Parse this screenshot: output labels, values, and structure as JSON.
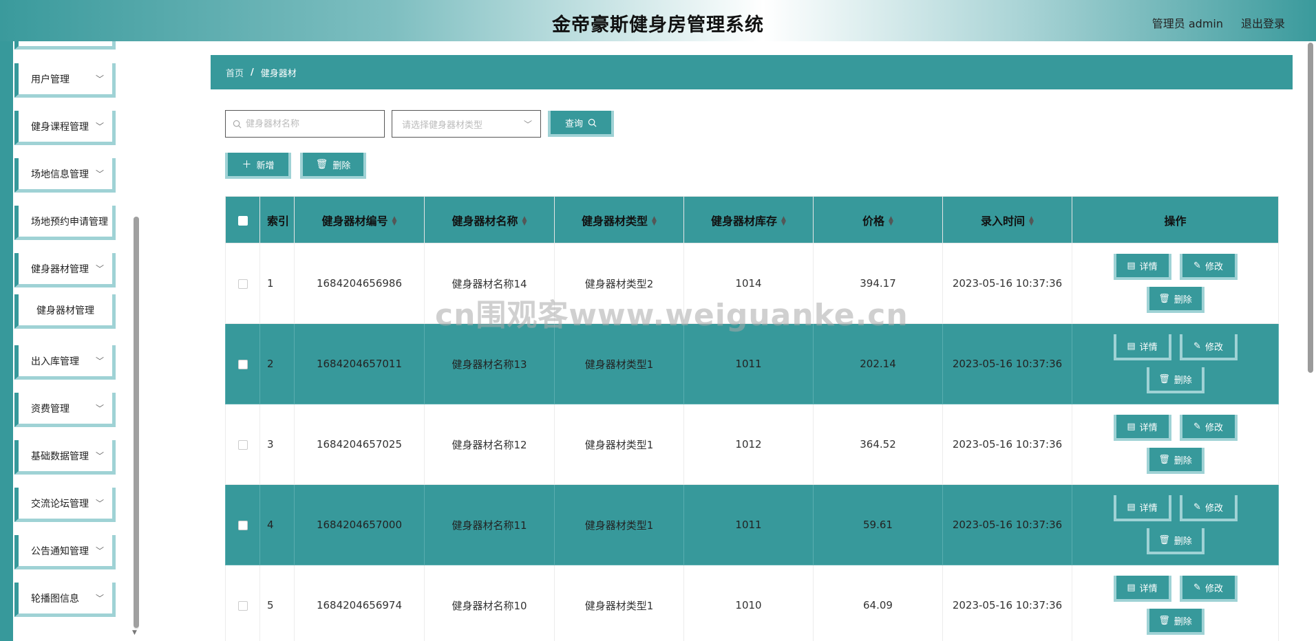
{
  "header": {
    "title": "金帝豪斯健身房管理系统",
    "user": "管理员 admin",
    "logout": "退出登录"
  },
  "sidebar": {
    "items": [
      {
        "label": "用户管理",
        "chevron": "﹀"
      },
      {
        "label": "健身课程管理",
        "chevron": "﹀"
      },
      {
        "label": "场地信息管理",
        "chevron": "﹀"
      },
      {
        "label": "场地预约申请管理",
        "chevron": ""
      },
      {
        "label": "健身器材管理",
        "chevron": "﹀"
      },
      {
        "label": "健身器材管理",
        "chevron": ""
      },
      {
        "label": "出入库管理",
        "chevron": "﹀"
      },
      {
        "label": "资费管理",
        "chevron": "﹀"
      },
      {
        "label": "基础数据管理",
        "chevron": "﹀"
      },
      {
        "label": "交流论坛管理",
        "chevron": "﹀"
      },
      {
        "label": "公告通知管理",
        "chevron": "﹀"
      },
      {
        "label": "轮播图信息",
        "chevron": "﹀"
      }
    ]
  },
  "breadcrumb": {
    "home": "首页",
    "sep": "/",
    "current": "健身器材"
  },
  "search": {
    "name_placeholder": "健身器材名称",
    "type_placeholder": "请选择健身器材类型",
    "query_label": "查询"
  },
  "toolbar": {
    "add_label": "新增",
    "delete_label": "删除"
  },
  "table": {
    "headers": {
      "index": "索引",
      "code": "健身器材编号",
      "name": "健身器材名称",
      "type": "健身器材类型",
      "stock": "健身器材库存",
      "price": "价格",
      "time": "录入时间",
      "ops": "操作"
    },
    "op_labels": {
      "detail": "详情",
      "edit": "修改",
      "delete": "删除"
    },
    "rows": [
      {
        "index": "1",
        "code": "1684204656986",
        "name": "健身器材名称14",
        "type": "健身器材类型2",
        "stock": "1014",
        "price": "394.17",
        "time": "2023-05-16 10:37:36"
      },
      {
        "index": "2",
        "code": "1684204657011",
        "name": "健身器材名称13",
        "type": "健身器材类型1",
        "stock": "1011",
        "price": "202.14",
        "time": "2023-05-16 10:37:36"
      },
      {
        "index": "3",
        "code": "1684204657025",
        "name": "健身器材名称12",
        "type": "健身器材类型1",
        "stock": "1012",
        "price": "364.52",
        "time": "2023-05-16 10:37:36"
      },
      {
        "index": "4",
        "code": "1684204657000",
        "name": "健身器材名称11",
        "type": "健身器材类型1",
        "stock": "1011",
        "price": "59.61",
        "time": "2023-05-16 10:37:36"
      },
      {
        "index": "5",
        "code": "1684204656974",
        "name": "健身器材名称10",
        "type": "健身器材类型1",
        "stock": "1010",
        "price": "64.09",
        "time": "2023-05-16 10:37:36"
      }
    ]
  },
  "watermark": "cn围观客www.weiguanke.cn",
  "colors": {
    "accent": "#37999b",
    "accent_light": "#9fd2d5"
  }
}
